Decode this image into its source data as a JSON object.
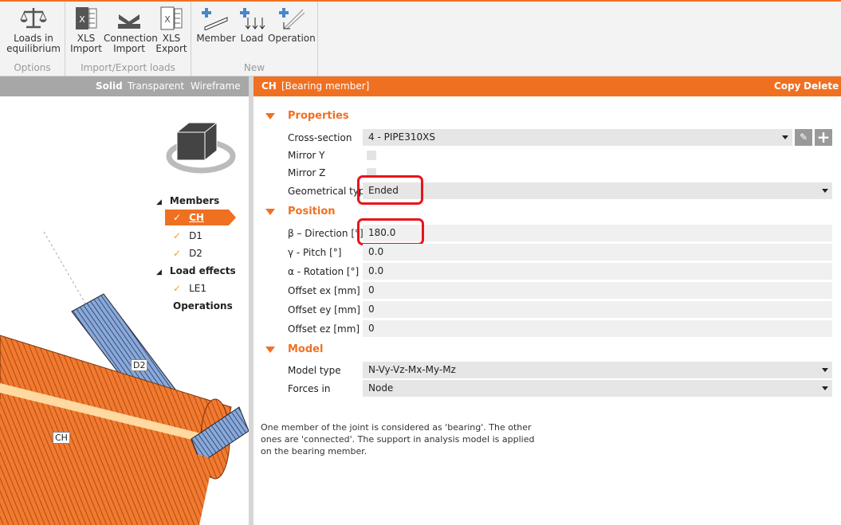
{
  "toolbar": {
    "groups": [
      {
        "label": "Options",
        "buttons": [
          {
            "label1": "Loads in",
            "label2": "equilibrium",
            "icon": "scale-icon"
          }
        ]
      },
      {
        "label": "Import/Export loads",
        "buttons": [
          {
            "label1": "XLS",
            "label2": "Import",
            "icon": "xls-import-icon"
          },
          {
            "label1": "Connection",
            "label2": "Import",
            "icon": "connection-import-icon"
          },
          {
            "label1": "XLS",
            "label2": "Export",
            "icon": "xls-export-icon"
          }
        ]
      },
      {
        "label": "New",
        "buttons": [
          {
            "label1": "Member",
            "icon": "add-member-icon"
          },
          {
            "label1": "Load",
            "icon": "add-load-icon"
          },
          {
            "label1": "Operation",
            "icon": "add-operation-icon"
          }
        ]
      }
    ]
  },
  "view": {
    "modes": [
      "Solid",
      "Transparent",
      "Wireframe"
    ],
    "labels": {
      "ch": "CH",
      "d2": "D2"
    }
  },
  "tree": {
    "members_label": "Members",
    "members": [
      "CH",
      "D1",
      "D2"
    ],
    "load_effects_label": "Load effects",
    "load_effects": [
      "LE1"
    ],
    "operations_label": "Operations"
  },
  "header": {
    "name": "CH",
    "type": "[Bearing member]",
    "copy": "Copy",
    "delete": "Delete"
  },
  "properties": {
    "title": "Properties",
    "cross_section_label": "Cross-section",
    "cross_section": "4 - PIPE310XS",
    "mirror_y_label": "Mirror Y",
    "mirror_z_label": "Mirror Z",
    "geom_type_label": "Geometrical type",
    "geom_type": "Ended"
  },
  "position": {
    "title": "Position",
    "rows": [
      {
        "label": "β – Direction [°]",
        "value": "180.0"
      },
      {
        "label": "γ - Pitch [°]",
        "value": "0.0"
      },
      {
        "label": "α - Rotation [°]",
        "value": "0.0"
      },
      {
        "label": "Offset ex [mm]",
        "value": "0"
      },
      {
        "label": "Offset ey [mm]",
        "value": "0"
      },
      {
        "label": "Offset ez [mm]",
        "value": "0"
      }
    ]
  },
  "model": {
    "title": "Model",
    "model_type_label": "Model type",
    "model_type": "N-Vy-Vz-Mx-My-Mz",
    "forces_in_label": "Forces in",
    "forces_in": "Node"
  },
  "note": "One member of the joint is considered as 'bearing'. The other ones are 'connected'. The support in analysis model is applied on the bearing member.",
  "colors": {
    "accent": "#f07022",
    "highlight": "#e8141b"
  }
}
